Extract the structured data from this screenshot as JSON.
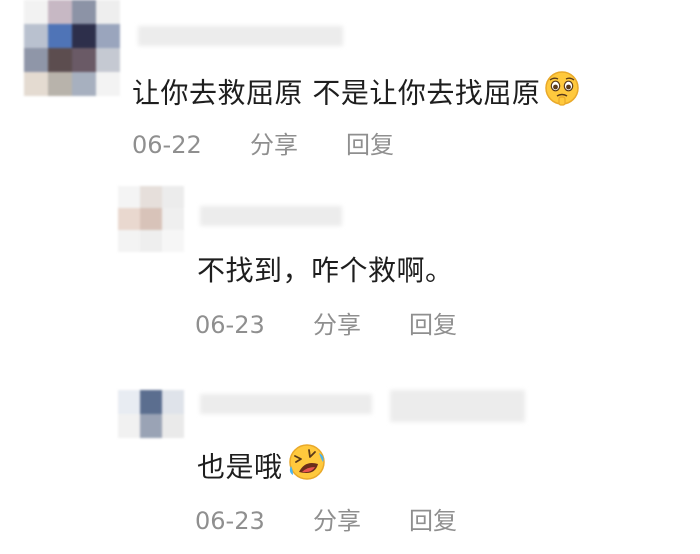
{
  "comments": [
    {
      "text": "让你去救屈原  不是让你去找屈原",
      "emoji": "pleading-face-icon",
      "date": "06-22",
      "share_label": "分享",
      "reply_label": "回复"
    },
    {
      "text": "不找到，咋个救啊。",
      "date": "06-23",
      "share_label": "分享",
      "reply_label": "回复"
    },
    {
      "text": "也是哦",
      "emoji": "rolling-laughing-icon",
      "date": "06-23",
      "share_label": "分享",
      "reply_label": "回复"
    }
  ],
  "colors": {
    "text": "#1e1e1e",
    "meta": "#8f8f8f",
    "emoji_yellow": "#ffc93d"
  }
}
